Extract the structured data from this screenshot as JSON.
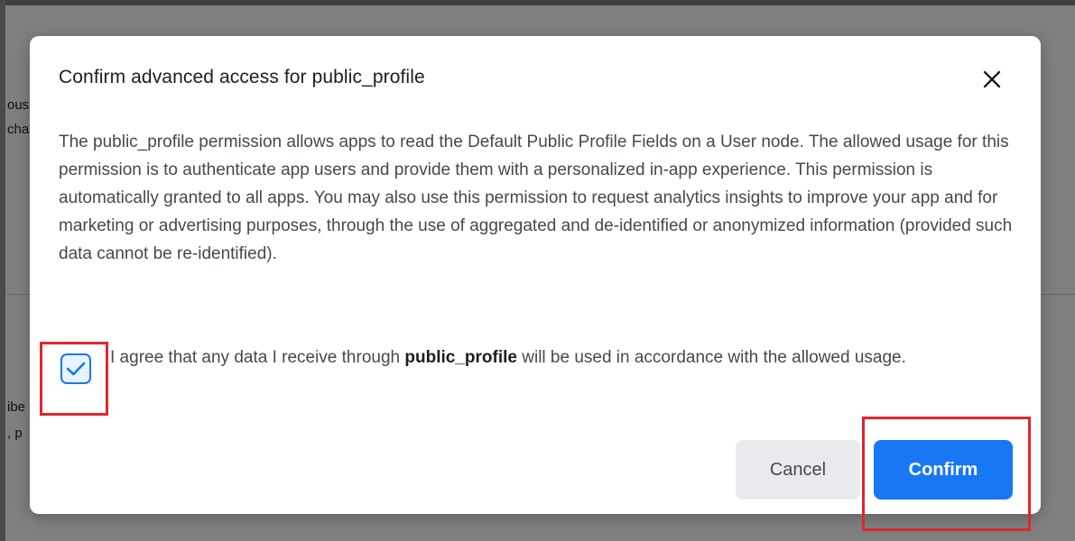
{
  "background": {
    "fragments": [
      "ous",
      "cha",
      "ibe",
      ", p"
    ]
  },
  "dialog": {
    "title": "Confirm advanced access for public_profile",
    "close_icon": "close-icon",
    "body": "The public_profile permission allows apps to read the Default Public Profile Fields on a User node. The allowed usage for this permission is to authenticate app users and provide them with a personalized in-app experience. This permission is automatically granted to all apps. You may also use this permission to request analytics insights to improve your app and for marketing or advertising purposes, through the use of aggregated and de-identified or anonymized information (provided such data cannot be re-identified).",
    "agreement": {
      "checked": true,
      "text_before": "I agree that any data I receive through ",
      "permission": "public_profile",
      "text_after": " will be used in accordance with the allowed usage."
    },
    "cancel_label": "Cancel",
    "confirm_label": "Confirm"
  },
  "colors": {
    "accent": "#1877f2",
    "highlight": "#e0252f"
  }
}
